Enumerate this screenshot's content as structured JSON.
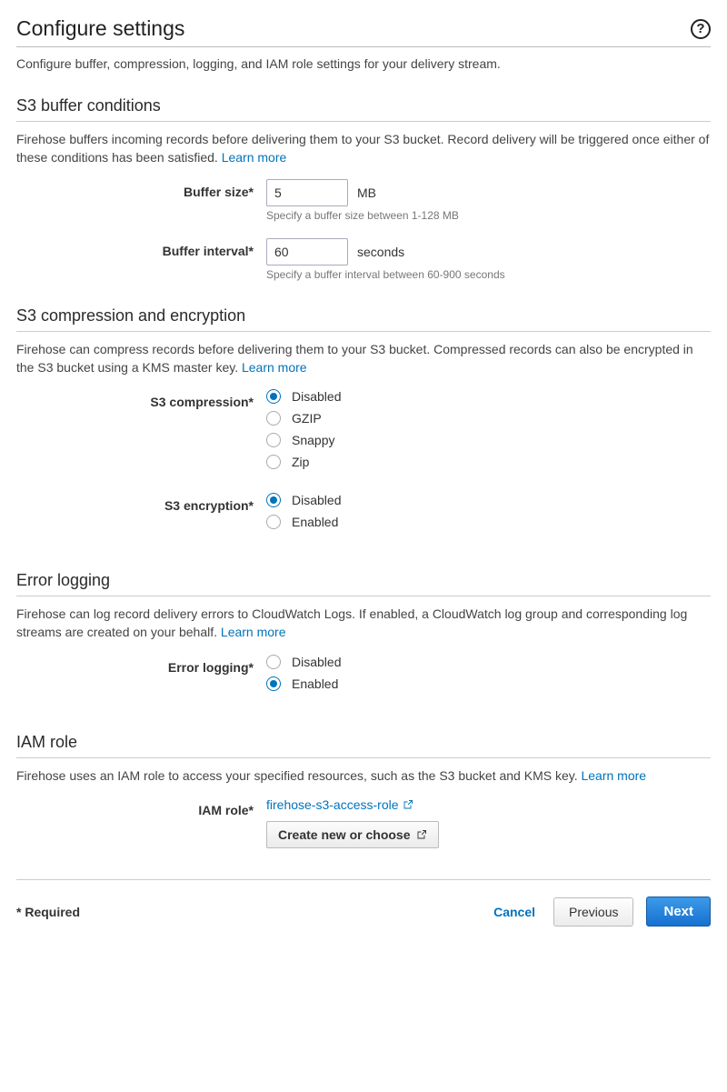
{
  "page": {
    "title": "Configure settings",
    "subtitle": "Configure buffer, compression, logging, and IAM role settings for your delivery stream."
  },
  "learn_more": "Learn more",
  "buffer": {
    "heading": "S3 buffer conditions",
    "desc": "Firehose buffers incoming records before delivering them to your S3 bucket. Record delivery will be triggered once either of these conditions has been satisfied. ",
    "size_label": "Buffer size*",
    "size_value": "5",
    "size_unit": "MB",
    "size_hint": "Specify a buffer size between 1-128 MB",
    "interval_label": "Buffer interval*",
    "interval_value": "60",
    "interval_unit": "seconds",
    "interval_hint": "Specify a buffer interval between 60-900 seconds"
  },
  "compenc": {
    "heading": "S3 compression and encryption",
    "desc": "Firehose can compress records before delivering them to your S3 bucket. Compressed records can also be encrypted in the S3 bucket using a KMS master key. ",
    "compression_label": "S3 compression*",
    "compression_options": [
      "Disabled",
      "GZIP",
      "Snappy",
      "Zip"
    ],
    "compression_selected": "Disabled",
    "encryption_label": "S3 encryption*",
    "encryption_options": [
      "Disabled",
      "Enabled"
    ],
    "encryption_selected": "Disabled"
  },
  "logging": {
    "heading": "Error logging",
    "desc": "Firehose can log record delivery errors to CloudWatch Logs. If enabled, a CloudWatch log group and corresponding log streams are created on your behalf. ",
    "label": "Error logging*",
    "options": [
      "Disabled",
      "Enabled"
    ],
    "selected": "Enabled"
  },
  "iam": {
    "heading": "IAM role",
    "desc": "Firehose uses an IAM role to access your specified resources, such as the S3 bucket and KMS key. ",
    "label": "IAM role*",
    "role_name": "firehose-s3-access-role",
    "button": "Create new or choose"
  },
  "footer": {
    "required": "* Required",
    "cancel": "Cancel",
    "previous": "Previous",
    "next": "Next"
  }
}
